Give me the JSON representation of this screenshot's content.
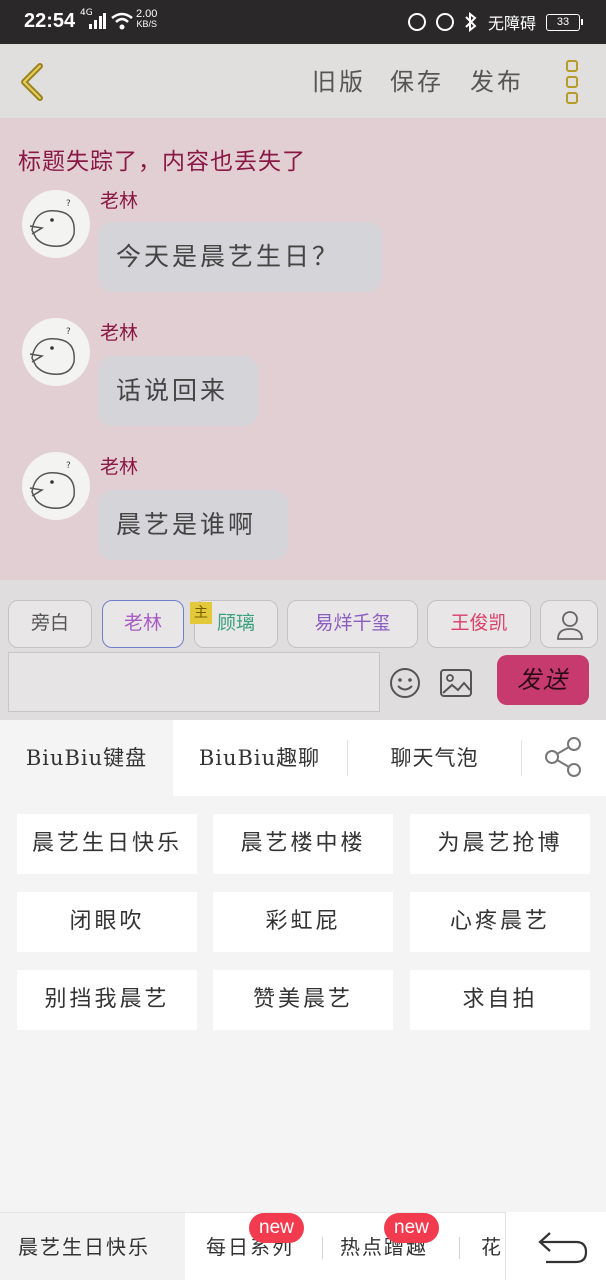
{
  "status_bar": {
    "time": "22:54",
    "network": "4G",
    "speed_value": "2.00",
    "speed_unit": "KB/S",
    "accessibility_label": "无障碍",
    "battery": "33"
  },
  "toolbar": {
    "old_version_label": "旧版",
    "save_label": "保存",
    "publish_label": "发布"
  },
  "chat": {
    "title": "标题失踪了，内容也丢失了",
    "messages": [
      {
        "sender": "老林",
        "text": "今天是晨艺生日？"
      },
      {
        "sender": "老林",
        "text": "话说回来"
      },
      {
        "sender": "老林",
        "text": "晨艺是谁啊"
      }
    ]
  },
  "roles": {
    "narration": "旁白",
    "items": [
      {
        "name": "老林",
        "color": "#a95bc4"
      },
      {
        "name": "顾璃",
        "color": "#3aa17e"
      },
      {
        "name": "易烊千玺",
        "color": "#8c5cc0"
      },
      {
        "name": "王俊凯",
        "color": "#d9406a"
      }
    ],
    "main_tag": "主"
  },
  "composer": {
    "input_placeholder": "",
    "send_label": "发送"
  },
  "panel": {
    "tabs": [
      "BiuBiu键盘",
      "BiuBiu趣聊",
      "聊天气泡"
    ],
    "phrases": [
      "晨艺生日快乐",
      "晨艺楼中楼",
      "为晨艺抢博",
      "闭眼吹",
      "彩虹屁",
      "心疼晨艺",
      "别挡我晨艺",
      "赞美晨艺",
      "求自拍"
    ]
  },
  "categories": {
    "items": [
      "晨艺生日快乐",
      "每日系列",
      "热点蹭趣",
      "花"
    ],
    "badge": "new"
  },
  "colors": {
    "accent": "#c73a6e",
    "chat_bg": "#e2cfd4",
    "title_color": "#8a1844"
  }
}
